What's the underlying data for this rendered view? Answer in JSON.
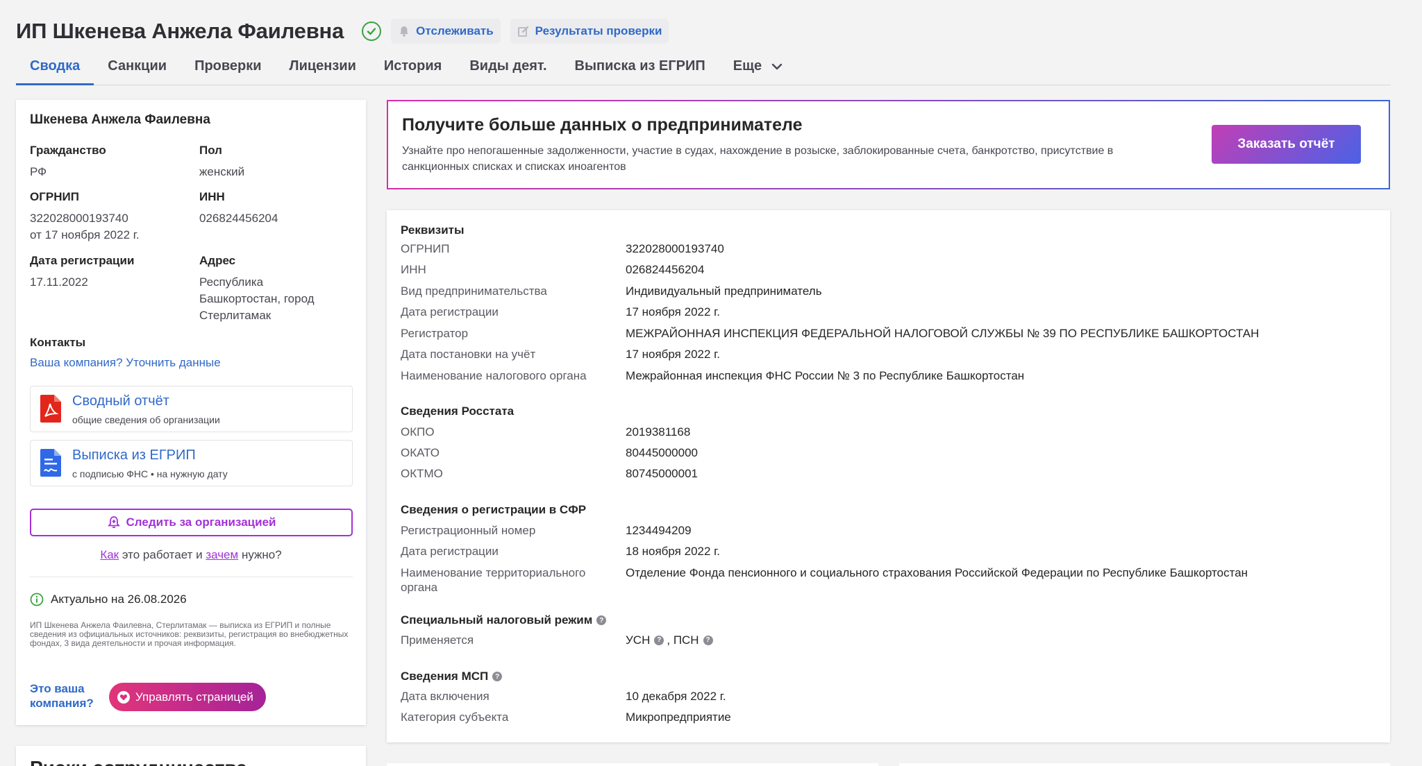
{
  "header": {
    "title": "ИП Шкенева Анжела Фаилевна",
    "track_label": "Отслеживать",
    "check_results_label": "Результаты проверки"
  },
  "tabs": [
    {
      "label": "Сводка"
    },
    {
      "label": "Санкции"
    },
    {
      "label": "Проверки"
    },
    {
      "label": "Лицензии"
    },
    {
      "label": "История"
    },
    {
      "label": "Виды деят."
    },
    {
      "label": "Выписка из ЕГРИП"
    },
    {
      "label": "Еще"
    }
  ],
  "summary": {
    "name": "Шкенева Анжела Фаилевна",
    "citizenship_label": "Гражданство",
    "citizenship": "РФ",
    "sex_label": "Пол",
    "sex": "женский",
    "ogrnip_label": "ОГРНИП",
    "ogrnip": "322028000193740",
    "ogrnip_date": "от 17 ноября 2022 г.",
    "inn_label": "ИНН",
    "inn": "026824456204",
    "reg_date_label": "Дата регистрации",
    "reg_date": "17.11.2022",
    "address_label": "Адрес",
    "address_line1": "Республика",
    "address_line2": "Башкортостан, город",
    "address_line3": "Стерлитамак",
    "contacts_label": "Контакты",
    "contacts_link": "Ваша компания? Уточнить данные",
    "doc1_title": "Сводный отчёт",
    "doc1_sub": "общие сведения об организации",
    "doc2_title": "Выписка из ЕГРИП",
    "doc2_sub": "с подписью ФНС • на нужную дату",
    "follow_label": "Следить за организацией",
    "how_link": "Как",
    "how_mid": "это работает и",
    "why_link": "зачем",
    "how_end": "нужно?",
    "actual": "Актуально на 26.08.2026",
    "description": "ИП Шкенева Анжела Фаилевна, Стерлитамак — выписка из ЕГРИП и полные сведения из официальных источников: реквизиты, регистрация во внебюджетных фондах, 3 вида деятельности и прочая информация.",
    "your_company": "Это ваша компания?",
    "manage_label": "Управлять страницей",
    "next_card_title": "Риски сотрудничества"
  },
  "promo": {
    "title": "Получите больше данных о предпринимателе",
    "description": "Узнайте про непогашенные задолженности, участие в судах, нахождение в розыске, заблокированные счета, банкротство, присутствие в санкционных списках и списках иноагентов",
    "button": "Заказать отчёт"
  },
  "requisites": {
    "title": "Реквизиты",
    "rows": [
      {
        "k": "ОГРНИП",
        "v": "322028000193740"
      },
      {
        "k": "ИНН",
        "v": "026824456204"
      },
      {
        "k": "Вид предпринимательства",
        "v": "Индивидуальный предприниматель"
      },
      {
        "k": "Дата регистрации",
        "v": "17 ноября 2022 г."
      },
      {
        "k": "Регистратор",
        "v": "МЕЖРАЙОННАЯ ИНСПЕКЦИЯ ФЕДЕРАЛЬНОЙ НАЛОГОВОЙ СЛУЖБЫ № 39 ПО РЕСПУБЛИКЕ БАШКОРТОСТАН"
      },
      {
        "k": "Дата постановки на учёт",
        "v": "17 ноября 2022 г."
      },
      {
        "k": "Наименование налогового органа",
        "v": "Межрайонная инспекция ФНС России № 3 по Республике Башкортостан"
      }
    ]
  },
  "rosstat": {
    "title": "Сведения Росстата",
    "rows": [
      {
        "k": "ОКПО",
        "v": "2019381168"
      },
      {
        "k": "ОКАТО",
        "v": "80445000000"
      },
      {
        "k": "ОКТМО",
        "v": "80745000001"
      }
    ]
  },
  "sfr": {
    "title": "Сведения о регистрации в СФР",
    "rows": [
      {
        "k": "Регистрационный номер",
        "v": "1234494209"
      },
      {
        "k": "Дата регистрации",
        "v": "18 ноября 2022 г."
      },
      {
        "k": "Наименование территориального органа",
        "v": "Отделение Фонда пенсионного и социального страхования Российской Федерации по Республике Башкортостан"
      }
    ]
  },
  "tax_regime": {
    "title": "Специальный налоговый режим",
    "applies_label": "Применяется",
    "regime1": "УСН",
    "regime2": "ПСН"
  },
  "msp": {
    "title": "Сведения МСП",
    "rows": [
      {
        "k": "Дата включения",
        "v": "10 декабря 2022 г."
      },
      {
        "k": "Категория субъекта",
        "v": "Микропредприятие"
      }
    ]
  },
  "colors": {
    "accent": "#2f69c8",
    "purple": "#a331d8",
    "verified": "#3aa33e"
  }
}
